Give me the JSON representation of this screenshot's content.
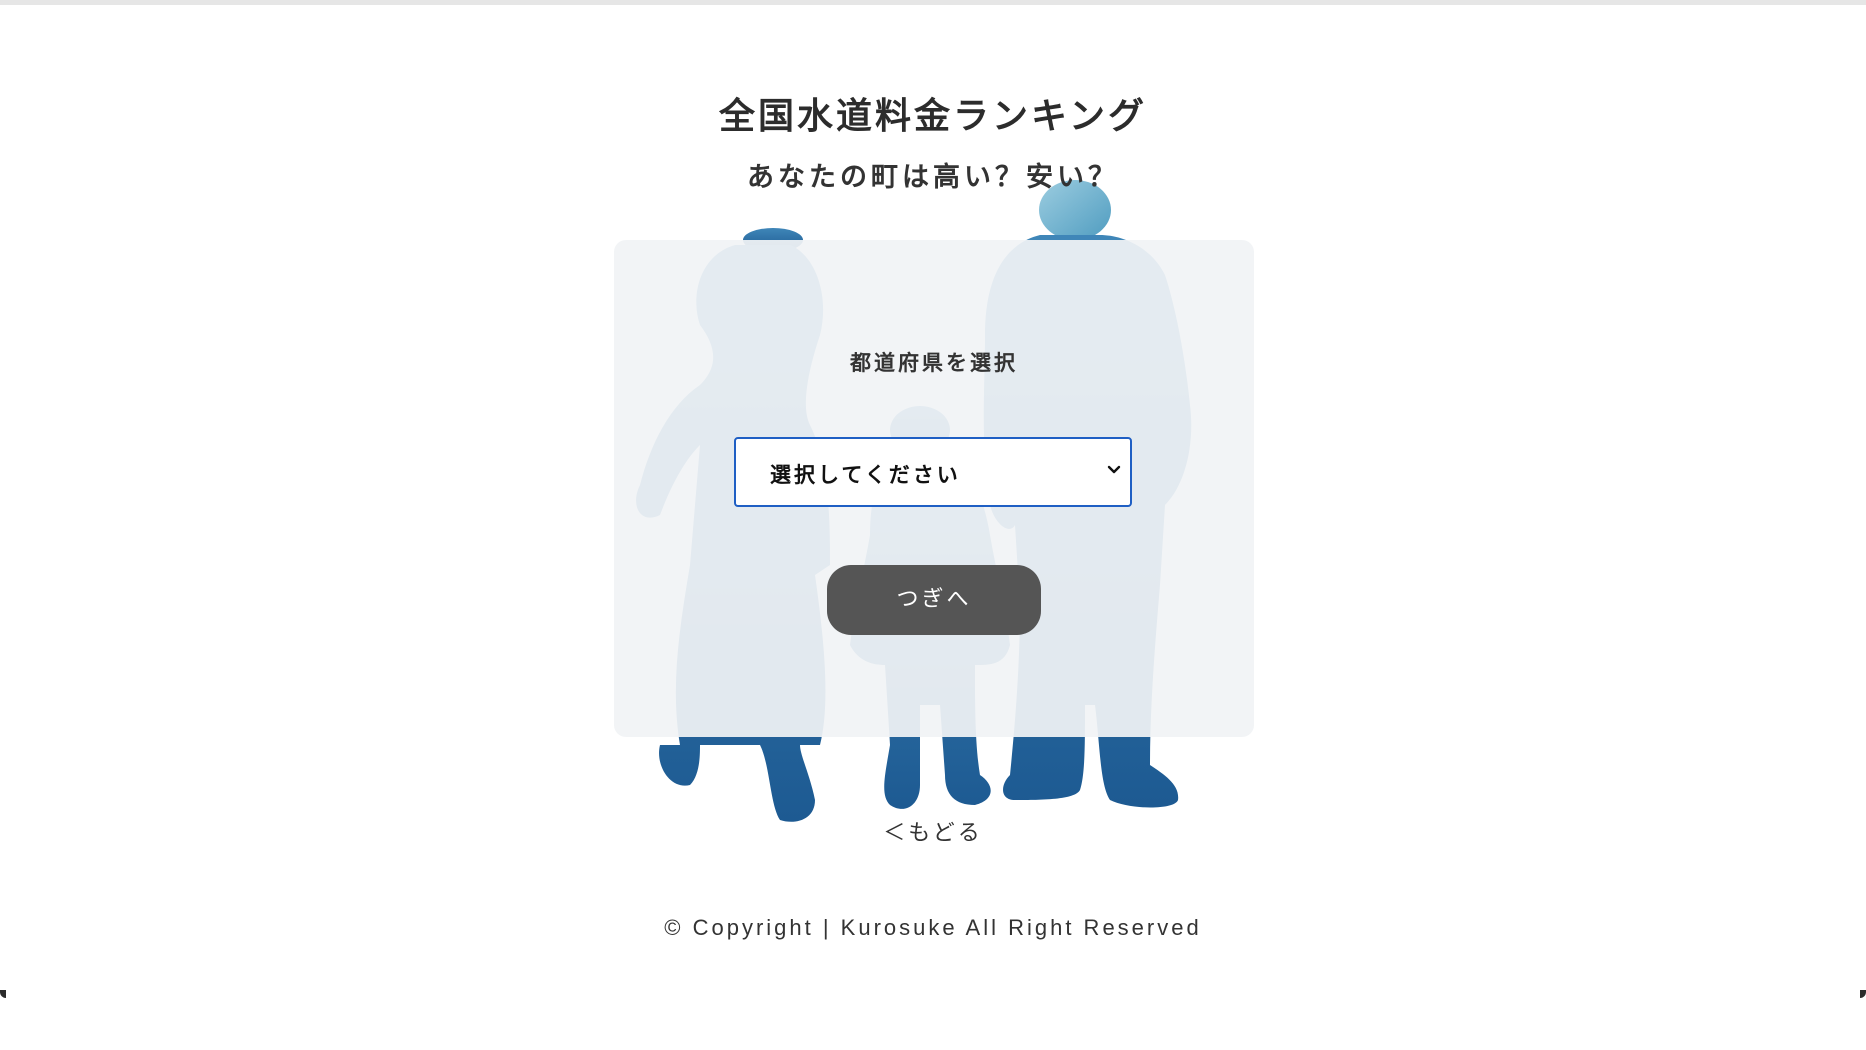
{
  "page": {
    "title": "全国水道料金ランキング",
    "subtitle": "あなたの町は高い？安い？"
  },
  "form": {
    "label": "都道府県を選択",
    "select_value": "選択してください",
    "next_button": "つぎへ"
  },
  "nav": {
    "back_link": "＜もどる"
  },
  "footer": {
    "copyright": "© Copyright | Kurosuke All Right Reserved"
  },
  "colors": {
    "water_blue": "#2a6aa3",
    "button_bg": "#555555",
    "select_border": "#1f5fc4",
    "card_bg": "#f1f3f5"
  },
  "icons": {
    "select_arrow": "chevron-down-icon",
    "background_art": "family-silhouette-illustration"
  }
}
